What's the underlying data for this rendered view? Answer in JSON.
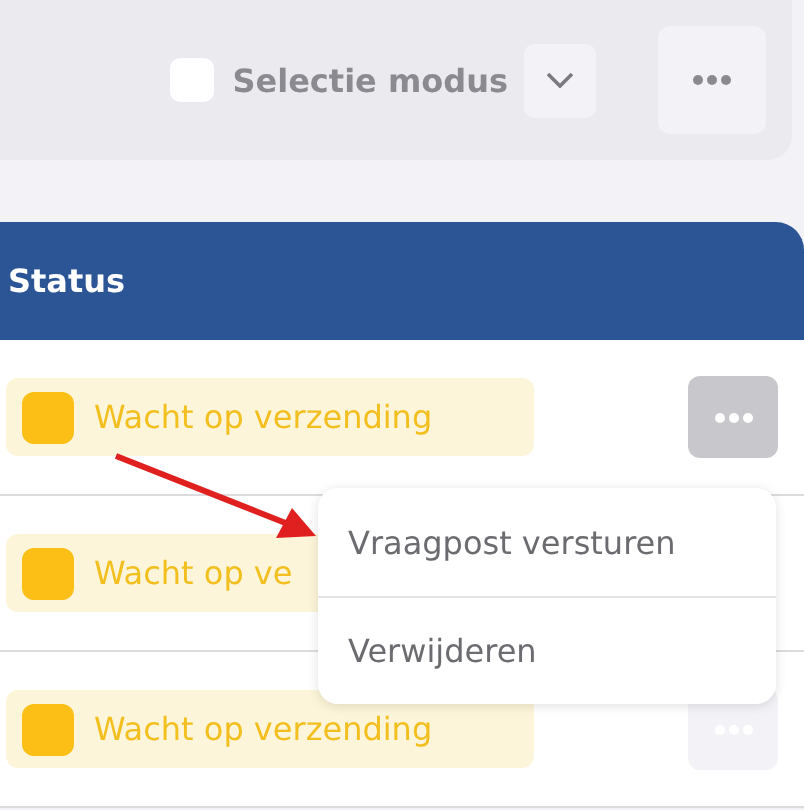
{
  "toolbar": {
    "selection_mode": {
      "label": "Selectie modus",
      "checked": false
    }
  },
  "table": {
    "columns": [
      "Status"
    ],
    "rows": [
      {
        "status": "Wacht op verzending",
        "actions_button": {
          "menu_open": true
        }
      },
      {
        "status": "Wacht op ve"
      },
      {
        "status": "Wacht op verzending",
        "actions_button": {
          "menu_open": false
        }
      }
    ]
  },
  "context_menu": {
    "items": [
      "Vraagpost versturen",
      "Verwijderen"
    ]
  }
}
